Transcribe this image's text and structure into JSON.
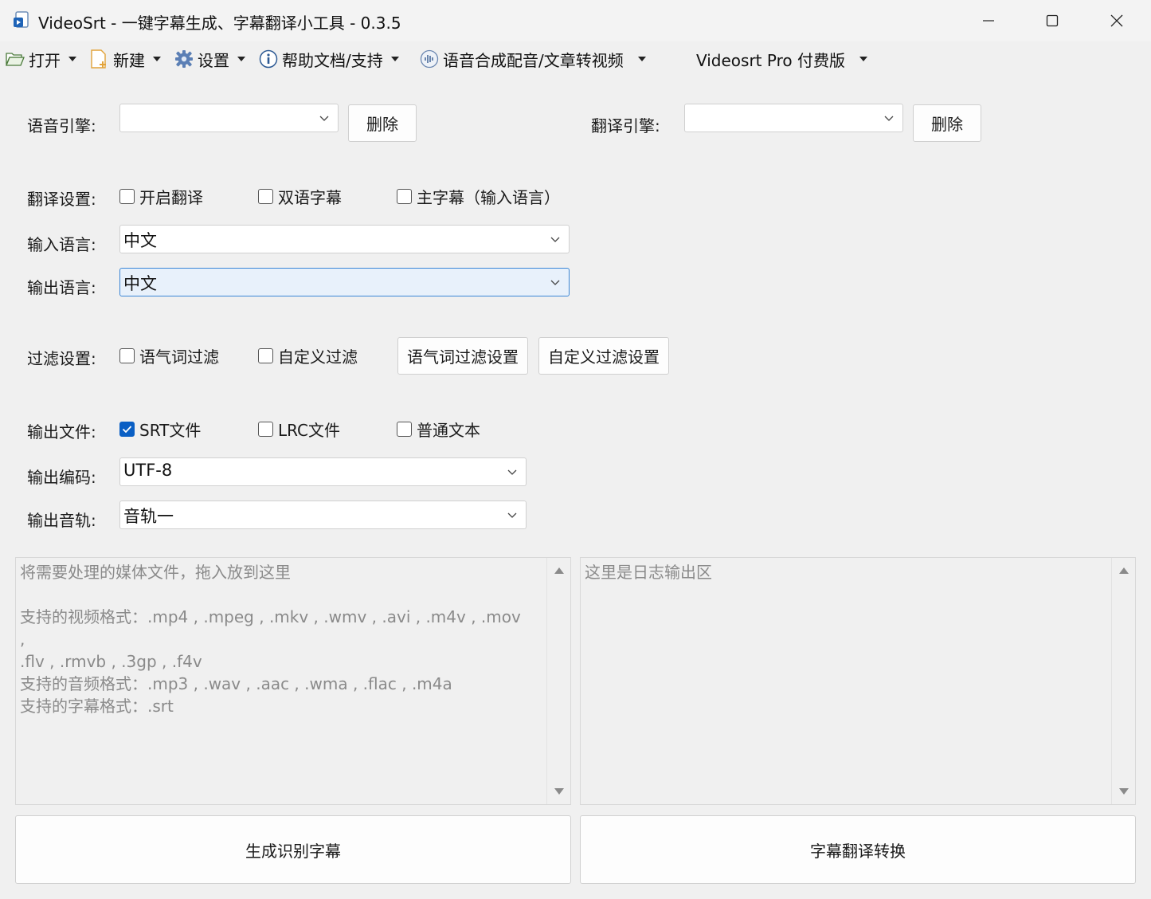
{
  "window": {
    "title": "VideoSrt - 一键字幕生成、字幕翻译小工具 - 0.3.5"
  },
  "menu": [
    {
      "label": "打开",
      "icon": "folder-open-icon"
    },
    {
      "label": "新建",
      "icon": "new-file-icon"
    },
    {
      "label": "设置",
      "icon": "gear-icon"
    },
    {
      "label": "帮助文档/支持",
      "icon": "info-icon"
    },
    {
      "label": "语音合成配音/文章转视频",
      "icon": "audio-wave-icon"
    },
    {
      "label": "Videosrt Pro 付费版",
      "icon": ""
    }
  ],
  "engines": {
    "speech_label": "语音引擎:",
    "speech_value": "",
    "speech_delete": "删除",
    "translate_label": "翻译引擎:",
    "translate_value": "",
    "translate_delete": "删除"
  },
  "translate_settings": {
    "label": "翻译设置:",
    "options": [
      {
        "label": "开启翻译",
        "checked": false
      },
      {
        "label": "双语字幕",
        "checked": false
      },
      {
        "label": "主字幕（输入语言）",
        "checked": false
      }
    ]
  },
  "input_language": {
    "label": "输入语言:",
    "value": "中文"
  },
  "output_language": {
    "label": "输出语言:",
    "value": "中文"
  },
  "filter_settings": {
    "label": "过滤设置:",
    "options": [
      {
        "label": "语气词过滤",
        "checked": false
      },
      {
        "label": "自定义过滤",
        "checked": false
      }
    ],
    "modal_button": "语气词过滤设置",
    "custom_button": "自定义过滤设置"
  },
  "output_files": {
    "label": "输出文件:",
    "options": [
      {
        "label": "SRT文件",
        "checked": true
      },
      {
        "label": "LRC文件",
        "checked": false
      },
      {
        "label": "普通文本",
        "checked": false
      }
    ]
  },
  "output_encoding": {
    "label": "输出编码:",
    "value": "UTF-8"
  },
  "output_track": {
    "label": "输出音轨:",
    "value": "音轨一"
  },
  "media_drop": {
    "lines": [
      "将需要处理的媒体文件，拖入放到这里",
      "",
      "支持的视频格式：.mp4 , .mpeg , .mkv , .wmv , .avi , .m4v , .mov ,",
      ".flv , .rmvb , .3gp , .f4v",
      "支持的音频格式：.mp3 , .wav , .aac , .wma , .flac , .m4a",
      "支持的字幕格式：.srt"
    ]
  },
  "log_area": {
    "placeholder": "这里是日志输出区"
  },
  "actions": {
    "generate": "生成识别字幕",
    "translate": "字幕翻译转换"
  },
  "colors": {
    "accent": "#0a5fc4",
    "focus_bg": "#e8f1fb"
  }
}
